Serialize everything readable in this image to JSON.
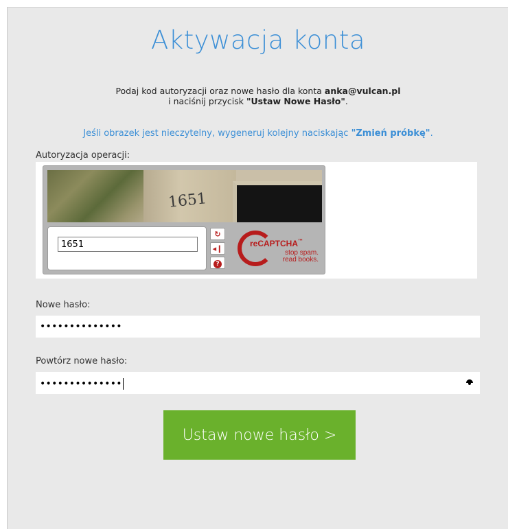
{
  "page": {
    "title": "Aktywacja konta",
    "info_line1_prefix": "Podaj kod autoryzacji oraz nowe hasło dla konta ",
    "info_email": "anka@vulcan.pl",
    "info_line2_prefix": "i naciśnij przycisk ",
    "info_button_name": "\"Ustaw Nowe Hasło\"",
    "info_line2_suffix": ".",
    "hint_prefix": "Jeśli obrazek jest nieczytelny, wygeneruj kolejny naciskając ",
    "hint_link": "\"Zmień próbkę\"",
    "hint_suffix": "."
  },
  "captcha": {
    "label": "Autoryzacja operacji:",
    "image_text": "1651",
    "input_value": "1651",
    "reload_icon": "refresh-icon",
    "audio_icon": "speaker-icon",
    "help_icon": "help-icon",
    "brand": "reCAPTCHA",
    "tm": "™",
    "tagline1": "stop spam.",
    "tagline2": "read books.",
    "accent_color": "#b71c1c"
  },
  "new_password": {
    "label": "Nowe hasło:",
    "value_masked": "••••••••••••••"
  },
  "repeat_password": {
    "label": "Powtórz nowe hasło:",
    "value_masked": "••••••••••••••",
    "reveal_icon": "eye-icon"
  },
  "submit": {
    "label": "Ustaw nowe hasło >",
    "color": "#6ab12c"
  },
  "colors": {
    "title": "#3c8fd6",
    "panel_bg": "#e9e9e9"
  }
}
